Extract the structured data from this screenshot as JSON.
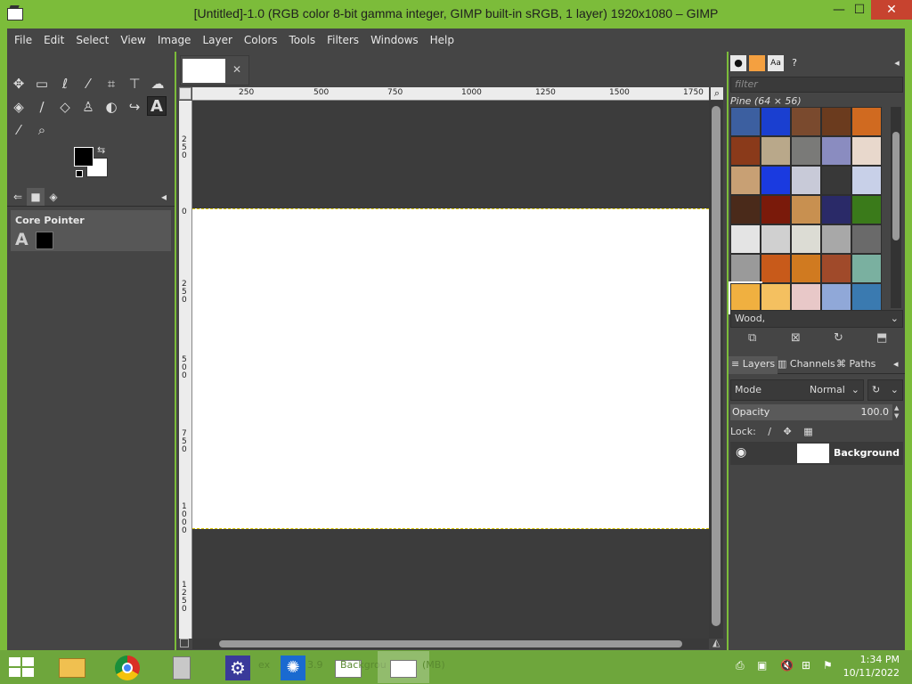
{
  "window": {
    "title": "[Untitled]-1.0 (RGB color 8-bit gamma integer, GIMP built-in sRGB, 1 layer) 1920x1080 – GIMP",
    "minimize": "—",
    "maximize": "☐",
    "close": "✕"
  },
  "menu": [
    "File",
    "Edit",
    "Select",
    "View",
    "Image",
    "Layer",
    "Colors",
    "Tools",
    "Filters",
    "Windows",
    "Help"
  ],
  "toolbox": {
    "tools": [
      {
        "name": "move-tool-icon",
        "glyph": "✥"
      },
      {
        "name": "rect-select-tool-icon",
        "glyph": "▭"
      },
      {
        "name": "free-select-tool-icon",
        "glyph": "ℓ"
      },
      {
        "name": "fuzzy-select-tool-icon",
        "glyph": "⁄"
      },
      {
        "name": "crop-tool-icon",
        "glyph": "⌗"
      },
      {
        "name": "align-tool-icon",
        "glyph": "⊤"
      },
      {
        "name": "warp-tool-icon",
        "glyph": "☁"
      },
      {
        "name": "bucket-fill-tool-icon",
        "glyph": "◈"
      },
      {
        "name": "paintbrush-tool-icon",
        "glyph": "∕"
      },
      {
        "name": "eraser-tool-icon",
        "glyph": "◇"
      },
      {
        "name": "clone-tool-icon",
        "glyph": "♙"
      },
      {
        "name": "smudge-tool-icon",
        "glyph": "◐"
      },
      {
        "name": "paths-tool-icon",
        "glyph": "↪"
      },
      {
        "name": "text-tool-icon",
        "glyph": "A"
      },
      {
        "name": "color-picker-tool-icon",
        "glyph": "⁄"
      },
      {
        "name": "zoom-tool-icon",
        "glyph": "⌕"
      }
    ],
    "swap_glyph": "⇆",
    "dock_tabs": [
      "⇐",
      "■",
      "◈"
    ],
    "tool_options_title": "Core Pointer",
    "tool_options_glyph": "A"
  },
  "canvas": {
    "h_ruler_ticks": [
      "250",
      "500",
      "750",
      "1000",
      "1250",
      "1500",
      "1750"
    ],
    "v_ruler_ticks": [
      "250",
      "0",
      "250",
      "500",
      "750",
      "1000",
      "1250"
    ],
    "close_glyph": "✕",
    "zoom_glyph": "⌕",
    "nav_glyph": "◭"
  },
  "patterns": {
    "filter_placeholder": "filter",
    "selected_name": "Pine (64 × 56)",
    "tag_value": "Wood,",
    "swatches": [
      "#3c5fa0",
      "#1a3fd0",
      "#7a4a2e",
      "#6b3b1e",
      "#d06a20",
      "#8a3a1a",
      "#b9a88a",
      "#7a7a78",
      "#8a8cc0",
      "#e8d8cc",
      "#c8a074",
      "#1a3ae0",
      "#c8cad8",
      "#383838",
      "#c8d0e8",
      "#4a2a1a",
      "#7a1a0a",
      "#c89050",
      "#2a2a68",
      "#3a7a1a",
      "#e4e4e4",
      "#d0d0d0",
      "#dcdcd4",
      "#a8a8a8",
      "#6a6a6a",
      "#9a9a9a",
      "#c85a1a",
      "#d07a20",
      "#a04a2a",
      "#7ab0a0",
      "#f0b040",
      "#f4c060",
      "#e8c8c8",
      "#90a8d8",
      "#3a7ab0"
    ]
  },
  "layers": {
    "tabs": [
      "Layers",
      "Channels",
      "Paths"
    ],
    "mode_label": "Mode",
    "mode_value": "Normal",
    "opacity_label": "Opacity",
    "opacity_value": "100.0",
    "lock_label": "Lock:",
    "layer_name": "Background"
  },
  "taskbar": {
    "ghost_text_1": "ex",
    "ghost_text_2": "3.9",
    "ghost_text_3": "Backgrou",
    "ghost_text_4": "(MB)",
    "time": "1:34 PM",
    "date": "10/11/2022"
  },
  "colors": {
    "accent": "#7cbc3a",
    "panel": "#454545",
    "close_button": "#c7432f"
  }
}
